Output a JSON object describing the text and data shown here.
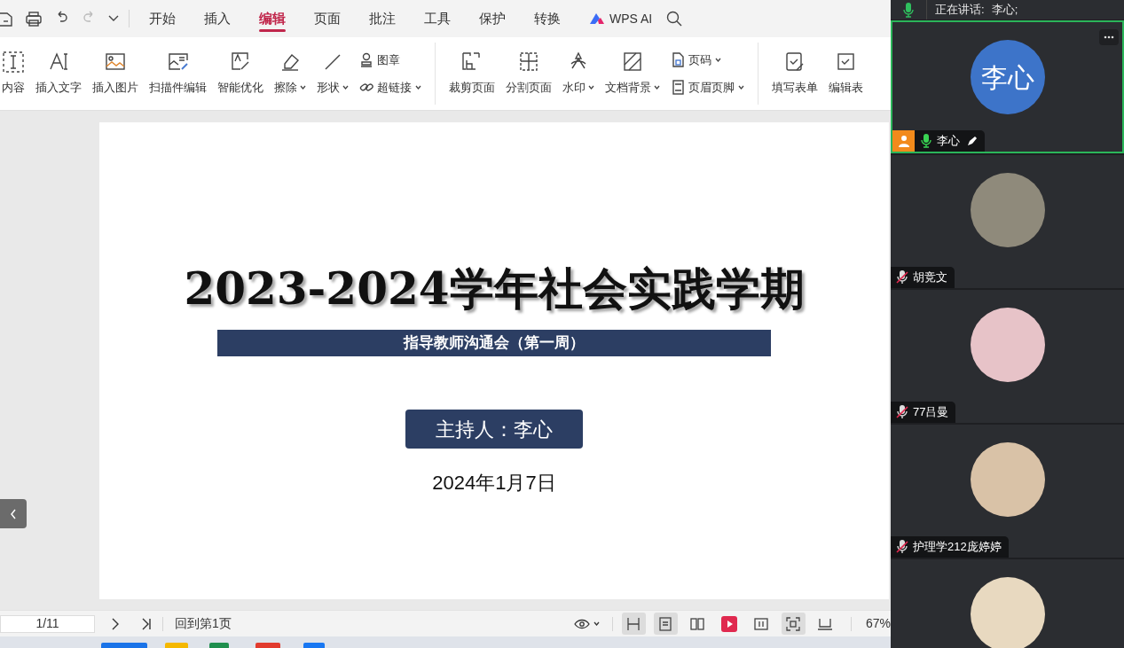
{
  "menu_tabs": [
    {
      "label": "开始",
      "selected": false
    },
    {
      "label": "插入",
      "selected": false
    },
    {
      "label": "编辑",
      "selected": true
    },
    {
      "label": "页面",
      "selected": false
    },
    {
      "label": "批注",
      "selected": false
    },
    {
      "label": "工具",
      "selected": false
    },
    {
      "label": "保护",
      "selected": false
    },
    {
      "label": "转换",
      "selected": false
    },
    {
      "label": "WPS AI",
      "selected": false,
      "kind": "ai"
    }
  ],
  "ribbon": [
    [
      {
        "kind": "large",
        "label": "内容",
        "dropdown": false
      },
      {
        "kind": "large",
        "label": "插入文字",
        "dropdown": false
      },
      {
        "kind": "large",
        "label": "插入图片",
        "dropdown": false
      },
      {
        "kind": "large",
        "label": "扫描件编辑",
        "dropdown": false
      },
      {
        "kind": "large",
        "label": "智能优化",
        "dropdown": false
      },
      {
        "kind": "large",
        "label": "擦除",
        "dropdown": true
      },
      {
        "kind": "large",
        "label": "形状",
        "dropdown": true
      },
      {
        "kind": "stack",
        "items": [
          {
            "label": "图章",
            "dropdown": false
          },
          {
            "label": "超链接",
            "dropdown": true
          }
        ]
      }
    ],
    [
      {
        "kind": "large",
        "label": "裁剪页面",
        "dropdown": false
      },
      {
        "kind": "large",
        "label": "分割页面",
        "dropdown": false
      },
      {
        "kind": "large",
        "label": "水印",
        "dropdown": true
      },
      {
        "kind": "large",
        "label": "文档背景",
        "dropdown": true
      },
      {
        "kind": "stack",
        "items": [
          {
            "label": "页码",
            "dropdown": true
          },
          {
            "label": "页眉页脚",
            "dropdown": true
          }
        ]
      }
    ],
    [
      {
        "kind": "large",
        "label": "填写表单",
        "dropdown": false
      },
      {
        "kind": "large",
        "label": "编辑表",
        "dropdown": false
      }
    ]
  ],
  "slide": {
    "title": "2023-2024学年社会实践学期",
    "subtitle": "指导教师沟通会（第一周）",
    "host": "主持人：李心",
    "date": "2024年1月7日"
  },
  "status_bar": {
    "page": "1/11",
    "back_to_first": "回到第1页",
    "view_buttons": [
      {
        "selected": true
      },
      {
        "selected": true
      },
      {
        "selected": false
      },
      {
        "selected": false
      },
      {
        "selected": false
      },
      {
        "selected": true
      },
      {
        "selected": false
      }
    ],
    "zoom": "67%"
  },
  "meeting": {
    "speaking_label": "正在讲话:",
    "speaking_name": "李心;",
    "participants": [
      {
        "name": "李心",
        "avatar_text": "李心",
        "muted": false,
        "active": true,
        "host": true
      },
      {
        "name": "胡竞文",
        "muted": true,
        "active": false,
        "host": false
      },
      {
        "name": "77吕曼",
        "muted": true,
        "active": false,
        "host": false
      },
      {
        "name": "护理学212庞婷婷",
        "muted": true,
        "active": false,
        "host": false
      },
      {
        "active": false,
        "host": false
      }
    ]
  }
}
